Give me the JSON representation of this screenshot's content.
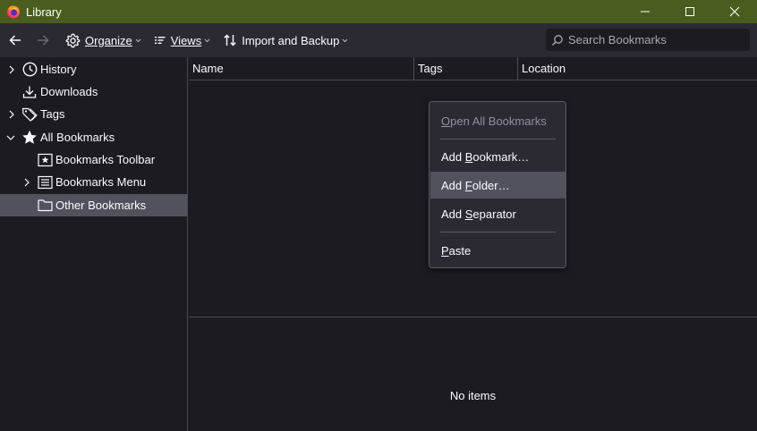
{
  "window": {
    "title": "Library",
    "controls": [
      "minimize-icon",
      "maximize-icon",
      "close-icon"
    ]
  },
  "toolbar": {
    "back_icon": "back-arrow-icon",
    "forward_icon": "forward-arrow-icon",
    "organize": {
      "label": "Organize",
      "icon": "gear-icon"
    },
    "views": {
      "label": "Views",
      "icon": "list-icon"
    },
    "import_backup": {
      "label": "Import and Backup",
      "icon": "sort-arrows-icon"
    },
    "search": {
      "placeholder": "Search Bookmarks",
      "value": ""
    }
  },
  "sidebar": {
    "items": [
      {
        "label": "History",
        "icon": "clock-icon",
        "expandable": true
      },
      {
        "label": "Downloads",
        "icon": "download-icon",
        "expandable": false
      },
      {
        "label": "Tags",
        "icon": "tag-icon",
        "expandable": true
      },
      {
        "label": "All Bookmarks",
        "icon": "star-icon",
        "expanded": true
      },
      {
        "label": "Bookmarks Toolbar",
        "icon": "bookmark-toolbar-icon",
        "expandable": false
      },
      {
        "label": "Bookmarks Menu",
        "icon": "bookmark-menu-icon",
        "expandable": true
      },
      {
        "label": "Other Bookmarks",
        "icon": "folder-icon",
        "selected": true
      }
    ]
  },
  "columns": [
    "Name",
    "Tags",
    "Location"
  ],
  "details": {
    "empty_text": "No items"
  },
  "context_menu": {
    "items": [
      {
        "pre": "",
        "key": "O",
        "post": "pen All Bookmarks",
        "disabled": true
      },
      {
        "pre": "Add ",
        "key": "B",
        "post": "ookmark…"
      },
      {
        "pre": "Add ",
        "key": "F",
        "post": "older…",
        "hovered": true
      },
      {
        "pre": "Add ",
        "key": "S",
        "post": "eparator"
      },
      {
        "pre": "",
        "key": "P",
        "post": "aste"
      }
    ]
  },
  "colors": {
    "titlebar": "#4b5d1e",
    "toolbar": "#2b2a33",
    "background": "#1c1b22",
    "selection": "#52525e"
  }
}
